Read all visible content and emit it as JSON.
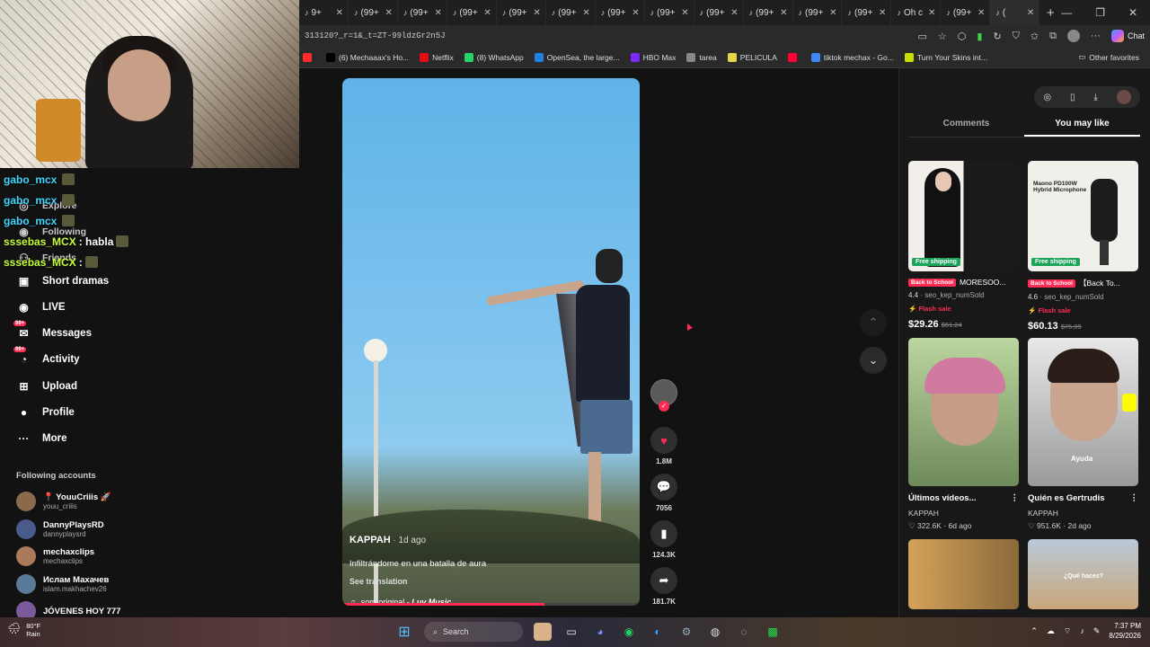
{
  "browser": {
    "tabs": [
      {
        "label": "9+",
        "active": false
      },
      {
        "label": "(99+",
        "active": false
      },
      {
        "label": "(99+",
        "active": false
      },
      {
        "label": "(99+",
        "active": false
      },
      {
        "label": "(99+",
        "active": false
      },
      {
        "label": "(99+",
        "active": false
      },
      {
        "label": "(99+",
        "active": false
      },
      {
        "label": "(99+",
        "active": false
      },
      {
        "label": "(99+",
        "active": false
      },
      {
        "label": "(99+",
        "active": false
      },
      {
        "label": "(99+",
        "active": false
      },
      {
        "label": "(99+",
        "active": false
      },
      {
        "label": "Oh c",
        "active": false
      },
      {
        "label": "(99+",
        "active": false
      },
      {
        "label": "(",
        "active": true
      }
    ],
    "url": "313120?_r=1&_t=ZT-99ldzGr2n5J",
    "chat_label": "Chat",
    "bookmarks": [
      {
        "label": "",
        "color": "#ff2a2a"
      },
      {
        "label": "(6) Mechaaax's Ho...",
        "color": "#000000"
      },
      {
        "label": "Netflix",
        "color": "#e50914"
      },
      {
        "label": "(8) WhatsApp",
        "color": "#25d366"
      },
      {
        "label": "OpenSea, the large...",
        "color": "#2081e2"
      },
      {
        "label": "HBO Max",
        "color": "#7b2cf0"
      },
      {
        "label": "tarea",
        "color": "#888888"
      },
      {
        "label": "PELICULA",
        "color": "#e8d24a"
      },
      {
        "label": "",
        "color": "#ff0033"
      },
      {
        "label": "tiktok mechax - Go...",
        "color": "#4285f4"
      },
      {
        "label": "Turn Your Skins int...",
        "color": "#c8e000"
      }
    ],
    "other_favorites": "Other favorites"
  },
  "stream_chat": [
    {
      "user": "gabo_mcx",
      "message": "",
      "color": "#40d8ff"
    },
    {
      "user": "gabo_mcx",
      "message": "",
      "color": "#40d8ff"
    },
    {
      "user": "gabo_mcx",
      "message": "",
      "color": "#40d8ff"
    },
    {
      "user": "sssebas_MCX",
      "message": ": habla",
      "color": "#c6ff3a"
    },
    {
      "user": "sssebas_MCX",
      "message": ":",
      "color": "#c6ff3a"
    }
  ],
  "sidebar": {
    "ghost_items": [
      "Explore",
      "Following",
      "Friends"
    ],
    "items": [
      {
        "label": "Short dramas",
        "icon": "film-icon",
        "badge": ""
      },
      {
        "label": "LIVE",
        "icon": "live-icon",
        "badge": ""
      },
      {
        "label": "Messages",
        "icon": "messages-icon",
        "badge": "99+"
      },
      {
        "label": "Activity",
        "icon": "activity-icon",
        "badge": "99+"
      },
      {
        "label": "Upload",
        "icon": "upload-icon",
        "badge": ""
      },
      {
        "label": "Profile",
        "icon": "profile-icon",
        "badge": ""
      },
      {
        "label": "More",
        "icon": "more-icon",
        "badge": ""
      }
    ],
    "following_header": "Following accounts",
    "accounts": [
      {
        "name": "📍 YouuCriiis 🚀",
        "handle": "youu_criiis"
      },
      {
        "name": "DannyPlaysRD",
        "handle": "dannyplaysrd"
      },
      {
        "name": "mechaxclips",
        "handle": "mechaxclips"
      },
      {
        "name": "Ислам Махачев",
        "handle": "islam.makhachev26"
      },
      {
        "name": "JÓVENES HOY 777",
        "handle": ""
      }
    ]
  },
  "video": {
    "author": "KAPPAH",
    "ago": " · 1d ago",
    "title": "Infiltrándome en una batalla de aura",
    "translation": "See translation",
    "music_prefix": "som original - ",
    "music_artist": "Luv Music",
    "progress": 0.68,
    "likes": "1.8M",
    "comments": "7056",
    "saves": "124.3K",
    "shares": "181.7K"
  },
  "right_panel": {
    "tabs": [
      "Comments",
      "You may like"
    ],
    "active_tab": "You may like",
    "products": [
      {
        "tag": "Back to School",
        "title": "MORESOO...",
        "rating": "4.4",
        "sold": "· seo_kep_numSold",
        "flash": "Flash sale",
        "price": "$29.26",
        "old_price": "$61.24",
        "shipping": "Free shipping"
      },
      {
        "tag": "Back to School",
        "title": "【Back To...",
        "rating": "4.6",
        "sold": "· seo_kep_numSold",
        "flash": "Flash sale",
        "price": "$60.13",
        "old_price": "$75.99",
        "shipping": "Free shipping"
      }
    ],
    "product2_banner": "Maono PD100W Hybrid Microphone",
    "videos": [
      {
        "title": "Últimos vídeos...",
        "author": "KAPPAH",
        "stats": "♡ 322.6K · 6d ago"
      },
      {
        "title": "Quién es Gertrudis",
        "author": "KAPPAH",
        "stats": "♡ 951.6K · 2d ago",
        "overlay": "Ayuda"
      }
    ],
    "thumb4_overlay": "¿Qué haces?"
  },
  "taskbar": {
    "temp": "80°F",
    "condition": "Rain",
    "search": "Search",
    "time": "7:37 PM",
    "date": "8/29/2026"
  }
}
